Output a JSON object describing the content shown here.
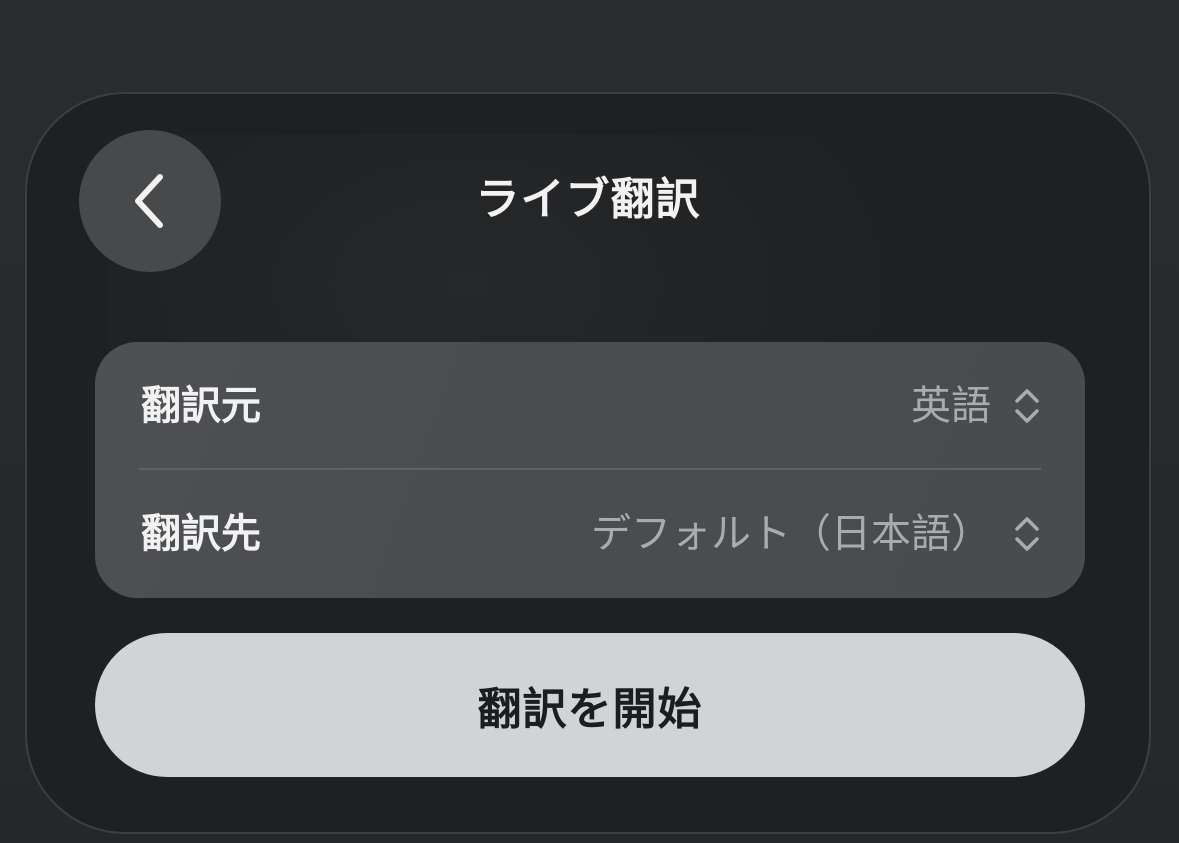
{
  "header": {
    "title": "ライブ翻訳",
    "back_icon": "chevron-left-icon"
  },
  "settings": {
    "source": {
      "label": "翻訳元",
      "value": "英語",
      "icon": "up-down-chevrons-icon"
    },
    "target": {
      "label": "翻訳先",
      "value": "デフォルト（日本語）",
      "icon": "up-down-chevrons-icon"
    }
  },
  "actions": {
    "start_label": "翻訳を開始"
  },
  "colors": {
    "background": "#26292c",
    "card": "#1e2022",
    "group": "#4b4e51",
    "button": "#d2d3d5",
    "text_primary": "#f2f2f2",
    "text_secondary": "#a9abad"
  }
}
